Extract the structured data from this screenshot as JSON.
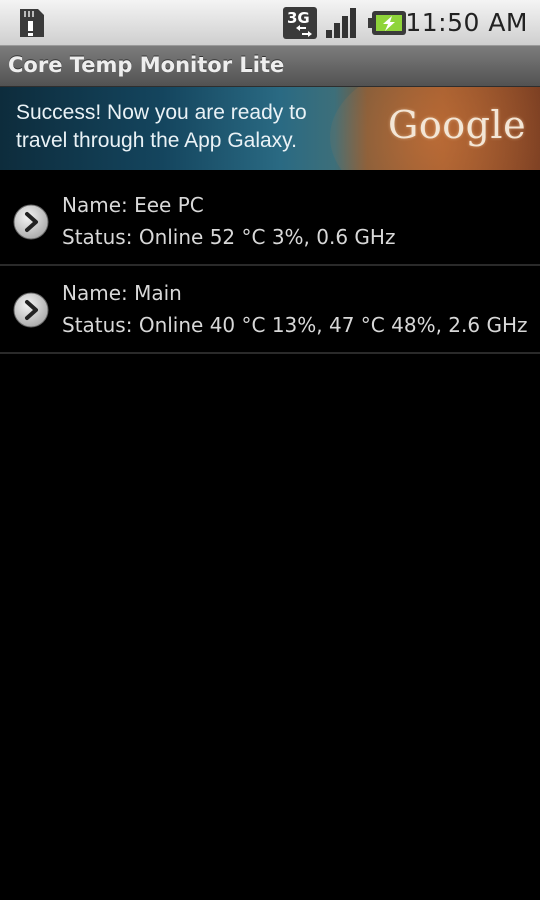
{
  "status_bar": {
    "time": "11:50 AM",
    "network": "3G",
    "icons": [
      "sd-card-icon",
      "network-3g-icon",
      "signal-icon",
      "battery-charging-icon"
    ]
  },
  "app": {
    "title": "Core Temp Monitor Lite"
  },
  "ad": {
    "line1": "Success! Now you are ready to",
    "line2": "travel through the App Galaxy.",
    "logo": "Google"
  },
  "devices": [
    {
      "name": "Name: Eee PC",
      "status": "Status: Online  52 °C 3%, 0.6 GHz"
    },
    {
      "name": "Name: Main",
      "status": "Status: Online  40 °C 13%, 47 °C 48%, 2.6 GHz"
    }
  ],
  "colors": {
    "background": "#000000",
    "titlebar": "#6a6a6a",
    "text": "#d8d8d8",
    "statusbar": "#e6e6e6"
  }
}
